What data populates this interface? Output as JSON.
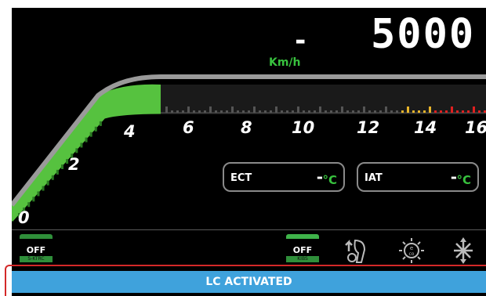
{
  "speed": {
    "value": "-",
    "unit": "Km/h"
  },
  "rpm": {
    "value": "5000"
  },
  "gauge": {
    "tick_labels": [
      "0",
      "2",
      "4",
      "6",
      "8",
      "10",
      "12",
      "14",
      "16"
    ],
    "filled_segment_value": 5.0,
    "colors": {
      "fill": "#56c23f",
      "track": "#9a9a9a",
      "warning": "#e8b42a",
      "redline": "#e02020"
    }
  },
  "readouts": {
    "ect": {
      "label": "ECT",
      "value": "-",
      "unit": "°C"
    },
    "iat": {
      "label": "IAT",
      "value": "-",
      "unit": "°C"
    }
  },
  "toggles": [
    {
      "state": "OFF",
      "tag": "S-KTRC",
      "bar_color": "#2f8f3a"
    },
    {
      "state": "OFF",
      "tag": "KIBS",
      "bar_color": "#3fb34a"
    }
  ],
  "icons": [
    "launch-control-icon",
    "eco-mode-icon",
    "quickshifter-icon"
  ],
  "banner": {
    "text": "LC ACTIVATED",
    "color": "#3fa2dc"
  }
}
